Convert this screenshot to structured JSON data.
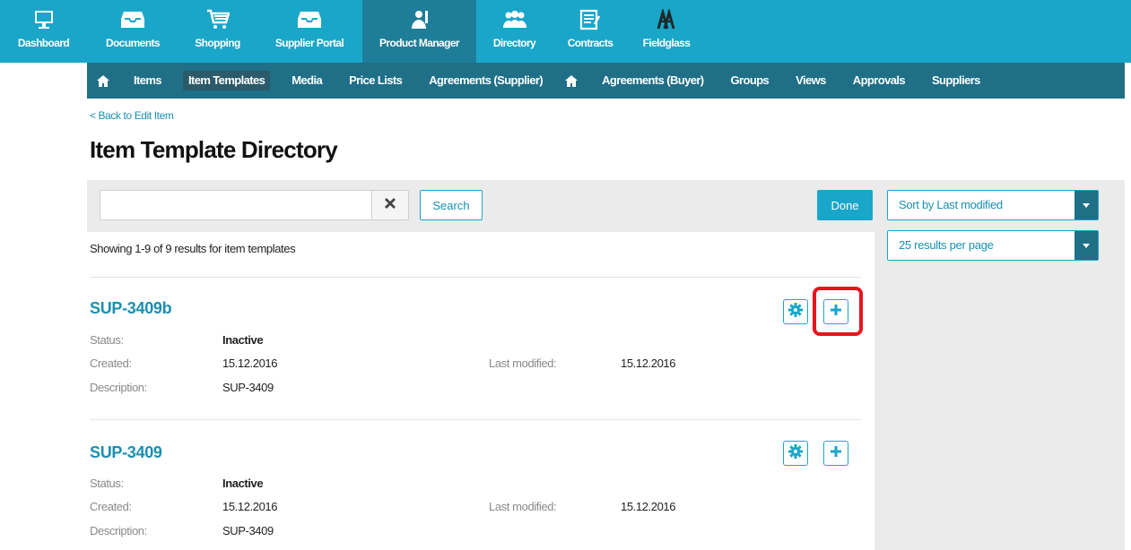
{
  "top_nav": [
    {
      "label": "Dashboard",
      "icon": "monitor-icon"
    },
    {
      "label": "Documents",
      "icon": "inbox-icon"
    },
    {
      "label": "Shopping",
      "icon": "cart-icon"
    },
    {
      "label": "Supplier Portal",
      "icon": "inbox-icon"
    },
    {
      "label": "Product Manager",
      "icon": "product-manager-icon",
      "active": true
    },
    {
      "label": "Directory",
      "icon": "people-icon"
    },
    {
      "label": "Contracts",
      "icon": "contract-icon"
    },
    {
      "label": "Fieldglass",
      "icon": "fieldglass-icon"
    }
  ],
  "sub_nav": {
    "items": [
      "Items",
      "Item Templates",
      "Media",
      "Price Lists",
      "Agreements (Supplier)",
      "Agreements (Buyer)",
      "Groups",
      "Views",
      "Approvals",
      "Suppliers"
    ],
    "active": "Item Templates"
  },
  "back_link": "< Back to Edit Item",
  "page_title": "Item Template Directory",
  "search": {
    "value": "",
    "placeholder": "",
    "button": "Search"
  },
  "done_button": "Done",
  "sort_select": "Sort by Last modified",
  "per_page_select": "25 results per page",
  "results_count": "Showing 1-9 of 9 results for item templates",
  "field_labels": {
    "status": "Status:",
    "created": "Created:",
    "description": "Description:",
    "last_modified": "Last modified:"
  },
  "templates": [
    {
      "name": "SUP-3409b",
      "status": "Inactive",
      "created": "15.12.2016",
      "description": "SUP-3409",
      "last_modified": "15.12.2016"
    },
    {
      "name": "SUP-3409",
      "status": "Inactive",
      "created": "15.12.2016",
      "description": "SUP-3409",
      "last_modified": "15.12.2016"
    }
  ],
  "colors": {
    "top_nav": "#1aa6c9",
    "top_nav_active": "#1e7d98",
    "sub_nav": "#1f6f87",
    "accent": "#1a8fb0",
    "highlight": "#e8141c"
  }
}
